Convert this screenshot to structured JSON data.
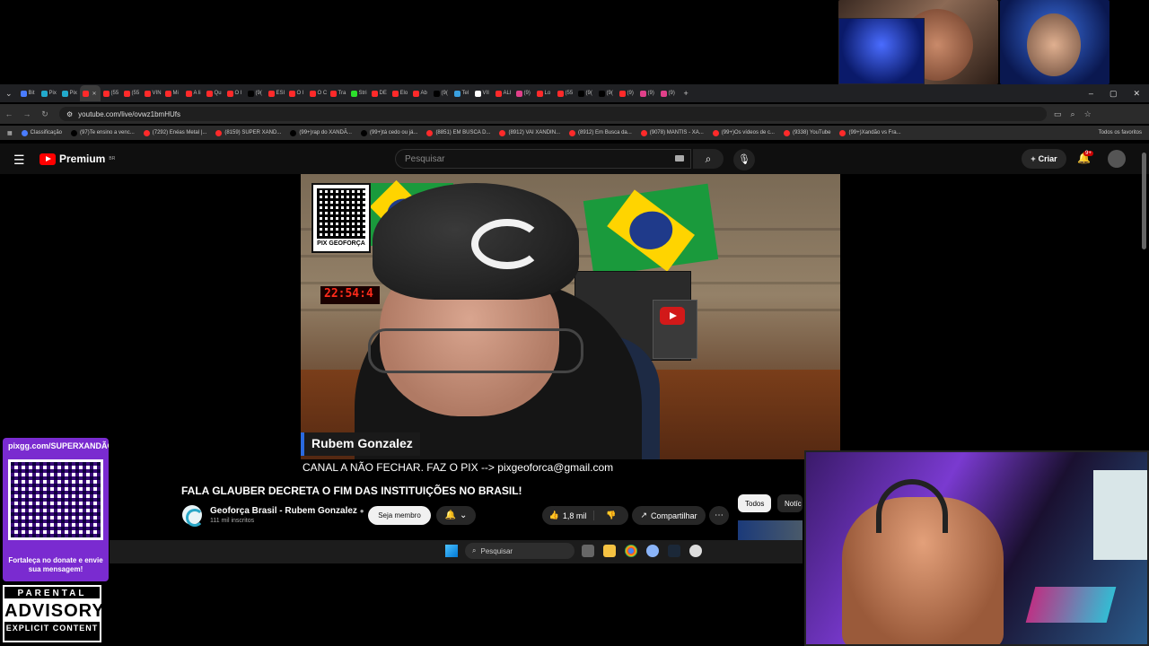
{
  "browser": {
    "tabs": [
      "Bit",
      "Pix",
      "Pix",
      "",
      "(55",
      "(55",
      "VIN",
      "Mi",
      "A li",
      "Qu",
      "O I",
      "(9(",
      "ESI",
      "O I",
      "O C",
      "Tra",
      "Stri",
      "DE",
      "Elo",
      "Ab",
      "(9(",
      "Tel",
      "VII",
      "ALI",
      "(9)",
      "Lo",
      "(55",
      "(9(",
      "(9(",
      "(9)",
      "(9)",
      "(9)"
    ],
    "url": "youtube.com/live/ovwz1bmHUfs",
    "bookmarks": [
      "Classificação",
      "(97)Te ensino a venc...",
      "(7292) Enéas Metal |...",
      "(8159) SUPER XAND...",
      "(99+)rap do XANDÃ...",
      "(99+)tá cedo ou já...",
      "(8851) EM BUSCA D...",
      "(8912) VAI XANDIN...",
      "(8912) Em Busca da...",
      "(9078) MANTIS - XA...",
      "(99+)Os vídeos de c...",
      "(9338) YouTube",
      "(99+)Xandão vs Fra..."
    ],
    "all_bookmarks": "Todos os favoritos"
  },
  "youtube": {
    "brand": "Premium",
    "region": "BR",
    "search_placeholder": "Pesquisar",
    "create_label": "Criar",
    "notif_count": "9+"
  },
  "video": {
    "qr_label": "PIX GEOFORÇA",
    "clock": "22:54:4",
    "lower_third": "Rubem Gonzalez",
    "ticker": "CANAL A NÃO FECHAR. FAZ O PIX --> pixgeoforca@gmail.com"
  },
  "watch": {
    "title": "FALA GLAUBER DECRETA O FIM DAS INSTITUIÇÕES NO BRASIL!",
    "channel": "Geoforça Brasil - Rubem Gonzalez",
    "subscribers": "111 mil inscritos",
    "member_label": "Seja membro",
    "likes": "1,8 mil",
    "share_label": "Compartilhar",
    "chips": [
      "Todos",
      "Notíc"
    ]
  },
  "taskbar": {
    "search": "Pesquisar"
  },
  "overlay": {
    "donate_url": "pixgg.com/SUPERXANDÃO",
    "donate_msg": "Fortaleça no donate e envie sua mensagem!",
    "advisory_1": "PARENTAL",
    "advisory_2": "ADVISORY",
    "advisory_3": "EXPLICIT CONTENT"
  }
}
